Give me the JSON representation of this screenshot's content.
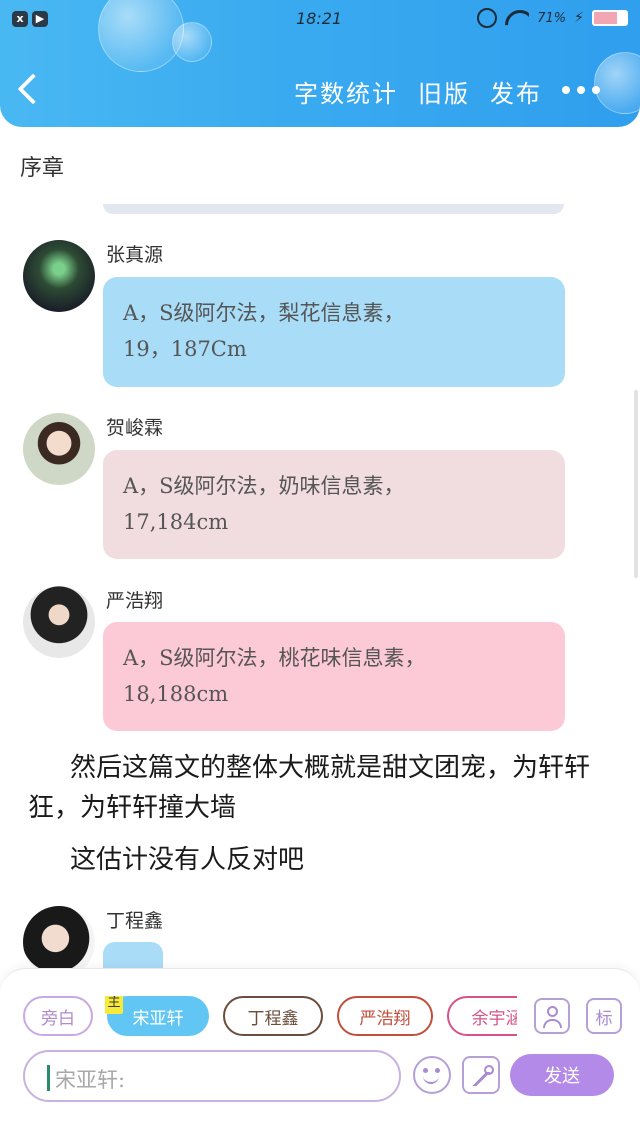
{
  "status_bar": {
    "time": "18:21",
    "battery_text": "71%",
    "left_icons": [
      "x-app-icon",
      "video-app-icon"
    ],
    "right_icons": [
      "alarm-icon",
      "wifi-icon",
      "charging-icon",
      "battery-icon"
    ],
    "battery_level": 0.71
  },
  "header": {
    "back_icon": "chevron-left-icon",
    "actions": {
      "word_count": "字数统计",
      "old_version": "旧版",
      "publish": "发布"
    },
    "more_icon": "more-dots-icon",
    "accent_color": "#3aaaf0"
  },
  "chapter": {
    "title": "序章"
  },
  "messages": [
    {
      "speaker": "张真源",
      "lines": [
        "A，S级阿尔法，梨花信息素，",
        "19，187Cm"
      ],
      "bubble_color": "#a9dcf7"
    },
    {
      "speaker": "贺峻霖",
      "lines": [
        "A，S级阿尔法，奶味信息素，",
        "17,184cm"
      ],
      "bubble_color": "#f1dde0"
    },
    {
      "speaker": "严浩翔",
      "lines": [
        "A，S级阿尔法，桃花味信息素，",
        "18,188cm"
      ],
      "bubble_color": "#fcc9d7"
    }
  ],
  "narration": [
    "然后这篇文的整体大概就是甜文团宠，为轩轩狂，为轩轩撞大墙",
    "这估计没有人反对吧"
  ],
  "pending_message": {
    "speaker": "丁程鑫"
  },
  "composer": {
    "chips": {
      "narration": "旁白",
      "active_main_tag": "主",
      "active": "宋亚轩",
      "c3": "丁程鑫",
      "c4": "严浩翔",
      "c5": "余宇涵"
    },
    "contact_icon": "contact-icon",
    "tag_label": "标",
    "input_placeholder": "宋亚轩:",
    "emoji_icon": "emoji-icon",
    "image_icon": "image-icon",
    "send_label": "发送",
    "send_color": "#b38ae8"
  }
}
